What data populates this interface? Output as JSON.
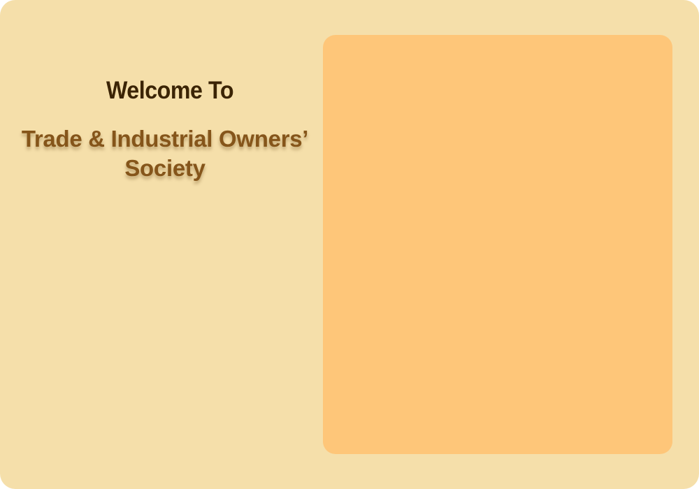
{
  "welcome": {
    "heading": "Welcome To",
    "society_name": "Trade & Industrial Owners’ Society"
  },
  "colors": {
    "background": "#f5dfaa",
    "panel": "#fec679",
    "heading_text": "#3b2405",
    "society_text": "#85551a"
  }
}
